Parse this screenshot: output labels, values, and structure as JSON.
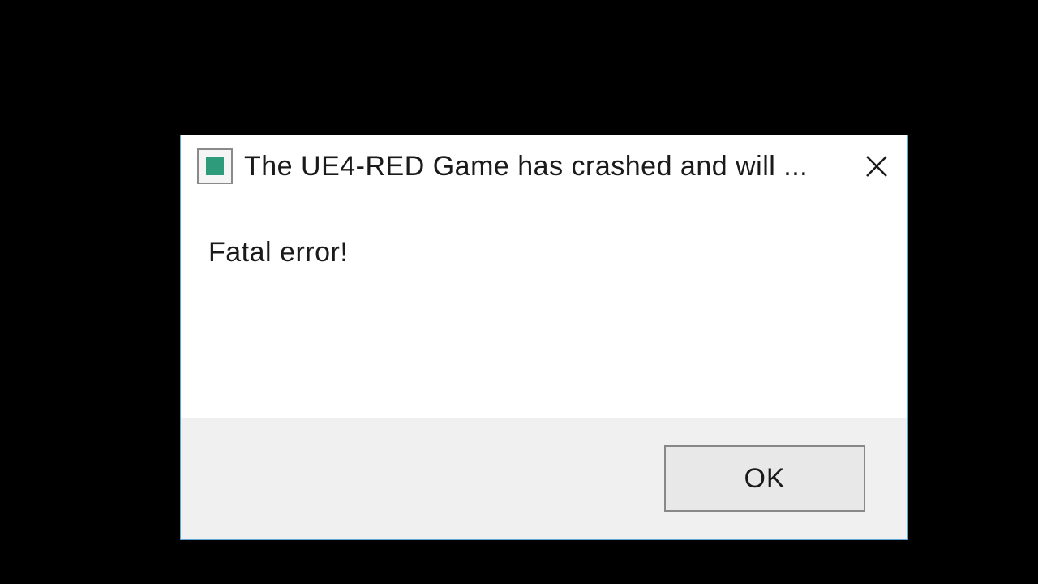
{
  "dialog": {
    "title": "The UE4-RED Game has crashed and will ...",
    "message": "Fatal error!",
    "ok_label": "OK"
  }
}
